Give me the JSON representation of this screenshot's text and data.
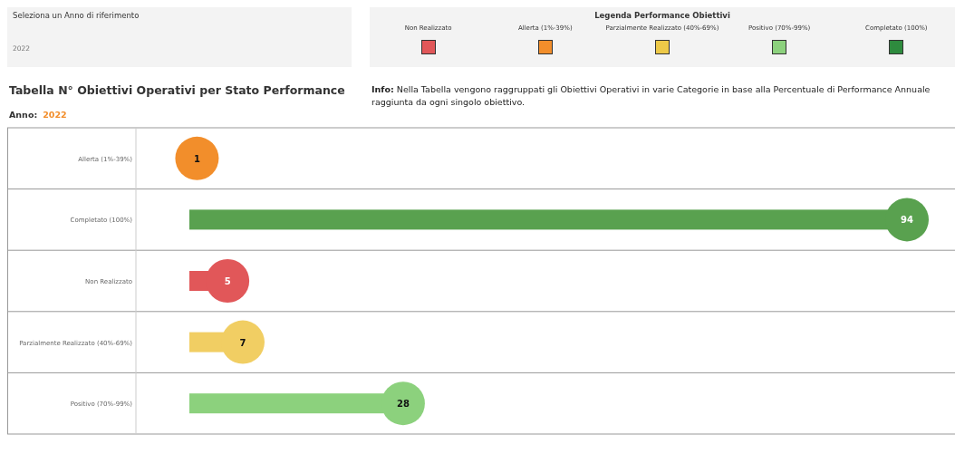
{
  "year_filter": {
    "label": "Seleziona un Anno di riferimento",
    "value": "2022"
  },
  "legend": {
    "title": "Legenda Performance Obiettivi",
    "items": [
      {
        "label": "Non Realizzato",
        "color": "#e15759"
      },
      {
        "label": "Allerta (1%-39%)",
        "color": "#f28e2b"
      },
      {
        "label": "Parzialmente Realizzato (40%-69%)",
        "color": "#edc948"
      },
      {
        "label": "Positivo (70%-99%)",
        "color": "#8cd17d"
      },
      {
        "label": "Completato (100%)",
        "color": "#2e8b3e"
      }
    ]
  },
  "title": "Tabella N° Obiettivi Operativi per Stato Performance",
  "info": "**Info:** Nella Tabella vengono raggruppati gli Obiettivi Operativi in varie Categorie in base alla Percentuale di  Performance Annuale raggiunta da ogni singolo obiettivo.",
  "year": {
    "label": "Anno:",
    "value": "2022"
  },
  "rows": [
    {
      "label": "Allerta (1%-39%)",
      "value": "1",
      "color": "#f28e2b"
    },
    {
      "label": "Completato (100%)",
      "value": "94",
      "color": "#59a14f"
    },
    {
      "label": "Non Realizzato",
      "value": "5",
      "color": "#e15759"
    },
    {
      "label": "Parzialmente Realizzato (40%-69%)",
      "value": "7",
      "color": "#f1ce63"
    },
    {
      "label": "Positivo (70%-99%)",
      "value": "28",
      "color": "#8cd17d"
    }
  ]
}
